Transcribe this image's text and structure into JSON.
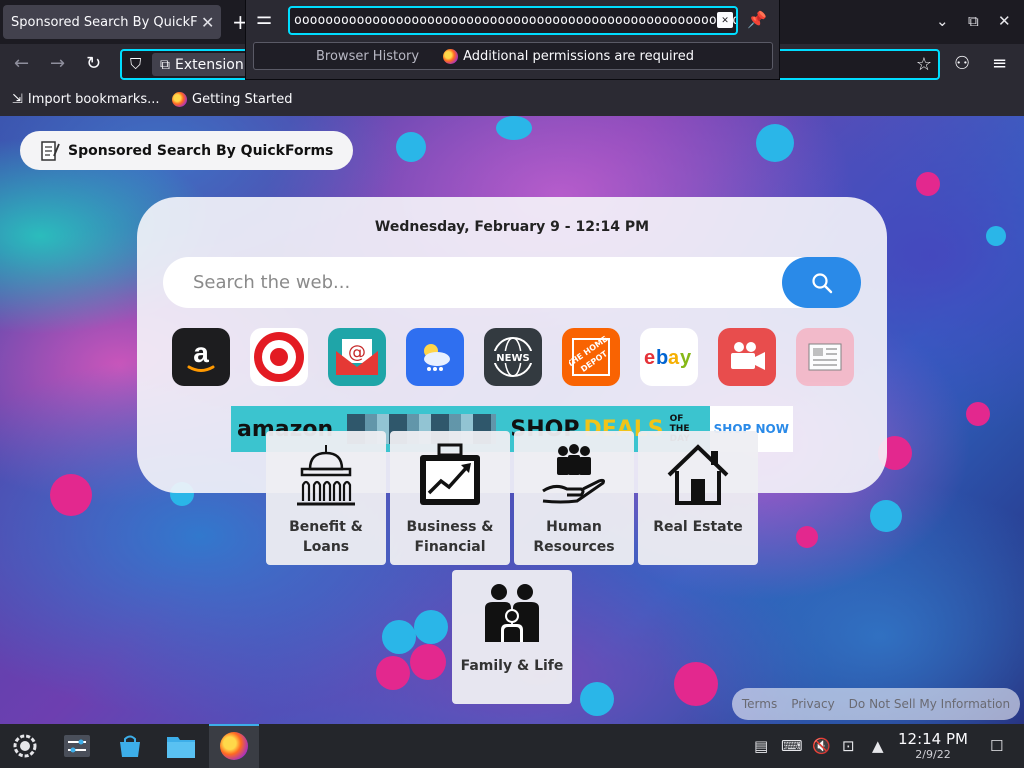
{
  "tab": {
    "title": "Sponsored Search By QuickForms",
    "close": "✕",
    "new_tab": "+"
  },
  "window_controls": {
    "minimize": "⌄",
    "restore": "⧉",
    "close": "✕"
  },
  "toolbar": {
    "url_chip_label": "Extension (",
    "back_icon": "←",
    "forward_icon": "→",
    "reload_icon": "↻",
    "star_icon": "☆",
    "menu_icon": "≡",
    "ext_icon": "⚇"
  },
  "bookmarks": [
    {
      "label": "Import bookmarks..."
    },
    {
      "label": "Getting Started"
    }
  ],
  "popup": {
    "input_value": "ooooooooooooooooooooooooooooooooooooooooooooooooooooooooooooooooooo",
    "history_label": "Browser History",
    "permission_label": "Additional permissions are required"
  },
  "page": {
    "brand": "Sponsored Search By QuickForms",
    "date": "Wednesday, February 9 - 12:14 PM",
    "search_placeholder": "Search the web...",
    "shortcuts": [
      {
        "name": "amazon",
        "color": "#1d1d1f"
      },
      {
        "name": "target",
        "color": "#e31b23"
      },
      {
        "name": "mail",
        "color": "#1fa5a8"
      },
      {
        "name": "weather",
        "color": "#2f6ff0"
      },
      {
        "name": "news",
        "color": "#333a40"
      },
      {
        "name": "home-depot",
        "color": "#f96302"
      },
      {
        "name": "ebay",
        "color": "#ffffff",
        "text": "ebay"
      },
      {
        "name": "video",
        "color": "#e84d4d"
      },
      {
        "name": "newspaper",
        "color": "#f4b6c6"
      }
    ],
    "banner": {
      "brand": "amazon",
      "shop": "SHOP",
      "deals": "DEALS",
      "of_the_day": "OF THE DAY",
      "shop_now": "SHOP NOW"
    },
    "tiles": [
      {
        "label_1": "Benefit &",
        "label_2": "Loans"
      },
      {
        "label_1": "Business &",
        "label_2": "Financial"
      },
      {
        "label_1": "Human",
        "label_2": "Resources"
      },
      {
        "label_1": "Real Estate",
        "label_2": ""
      },
      {
        "label_1": "Family & Life",
        "label_2": ""
      }
    ],
    "footer": {
      "terms": "Terms",
      "privacy": "Privacy",
      "dnsmi": "Do Not Sell My Information"
    }
  },
  "taskbar": {
    "time": "12:14 PM",
    "date": "2/9/22"
  },
  "colors": {
    "accent": "#00ddff",
    "search_button": "#2a8ae8",
    "taskbar_highlight": "#3daee9"
  }
}
